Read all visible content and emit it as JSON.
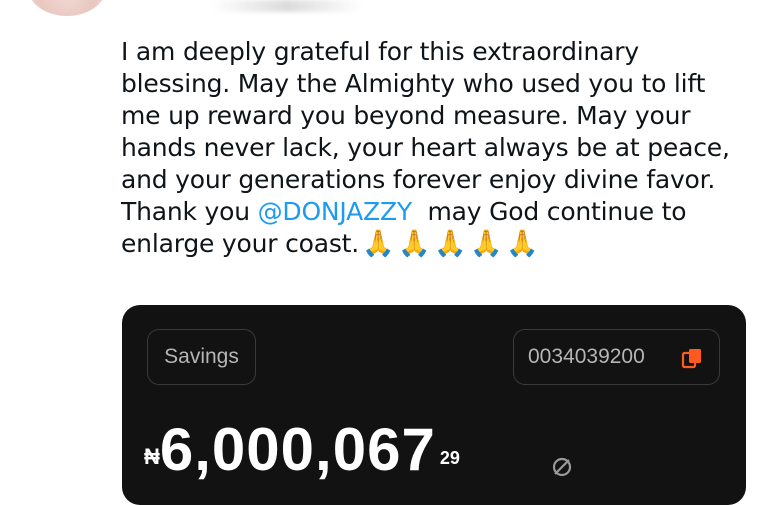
{
  "tweet": {
    "lines": [
      "I am deeply grateful for this extraordinary",
      "blessing. May the Almighty who used you to lift",
      "me up reward you beyond measure. May your",
      "hands never lack, your heart always be at peace,",
      "and your generations forever enjoy divine favor."
    ],
    "line6_prefix": "Thank you ",
    "mention": "@DONJAZZY",
    "line6_suffix": "  may God continue to",
    "line7": "enlarge your coast.",
    "emojis": [
      "🙏",
      "🙏",
      "🙏",
      "🙏",
      "🙏"
    ]
  },
  "account_card": {
    "account_type": "Savings",
    "account_number": "0034039200",
    "currency_symbol": "₦",
    "balance_main": "6,000,067",
    "balance_decimal": "29",
    "accent_color": "#ff5a1f",
    "icons": {
      "copy": "copy-icon",
      "visibility": "eye-slash-icon"
    }
  }
}
